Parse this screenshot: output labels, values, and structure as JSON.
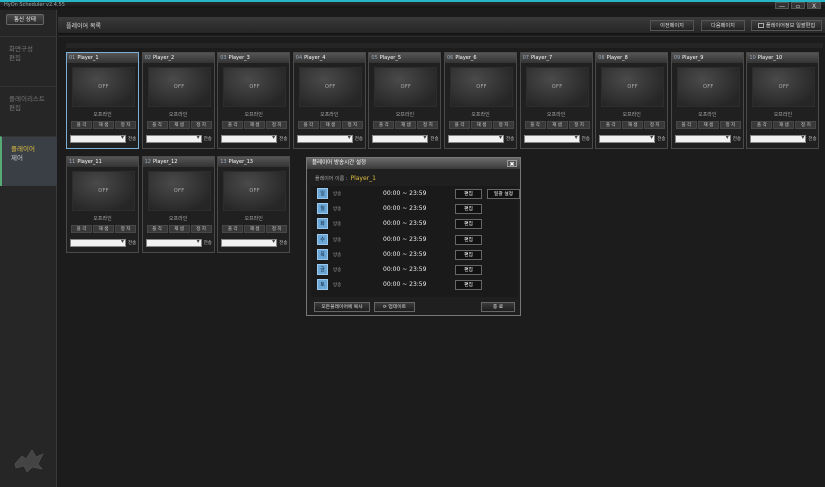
{
  "window": {
    "title": "HyOn Scheduler v2.4.55",
    "min": "—",
    "max": "▫",
    "close": "X"
  },
  "sidebar": {
    "comm_button": "통신 상태",
    "items": [
      {
        "line1": "화면구성",
        "line2": "편집"
      },
      {
        "line1": "플레이리스트",
        "line2": "편집"
      },
      {
        "line1": "플레이어",
        "line2": "제어"
      }
    ]
  },
  "header": {
    "title": "플레이어 목록",
    "prev": "이전페이지",
    "next": "다음페이지",
    "info": "플레이어정보 일괄편집"
  },
  "card_labels": {
    "screen": "OFF",
    "status": "오프라인",
    "play": "플 각",
    "reset": "재 샘",
    "stop": "정 지",
    "send": "전송"
  },
  "players": [
    {
      "num": "01",
      "name": "Player_1"
    },
    {
      "num": "02",
      "name": "Player_2"
    },
    {
      "num": "03",
      "name": "Player_3"
    },
    {
      "num": "04",
      "name": "Player_4"
    },
    {
      "num": "05",
      "name": "Player_5"
    },
    {
      "num": "06",
      "name": "Player_6"
    },
    {
      "num": "07",
      "name": "Player_7"
    },
    {
      "num": "08",
      "name": "Player_8"
    },
    {
      "num": "09",
      "name": "Player_9"
    },
    {
      "num": "10",
      "name": "Player_10"
    },
    {
      "num": "11",
      "name": "Player_11"
    },
    {
      "num": "12",
      "name": "Player_12"
    },
    {
      "num": "13",
      "name": "Player_13"
    }
  ],
  "dialog": {
    "title": "플레이어 방송시간 설정",
    "close": "✖",
    "player_label": "플레이어 이름 :",
    "player_name": "Player_1",
    "edit_label": "편집",
    "batch_label": "일괄 설정",
    "rows": [
      {
        "day": "일",
        "label": "방송",
        "time": "00:00 ~ 23:59"
      },
      {
        "day": "월",
        "label": "방송",
        "time": "00:00 ~ 23:59"
      },
      {
        "day": "화",
        "label": "방송",
        "time": "00:00 ~ 23:59"
      },
      {
        "day": "수",
        "label": "방송",
        "time": "00:00 ~ 23:59"
      },
      {
        "day": "목",
        "label": "방송",
        "time": "00:00 ~ 23:59"
      },
      {
        "day": "금",
        "label": "방송",
        "time": "00:00 ~ 23:59"
      },
      {
        "day": "토",
        "label": "방송",
        "time": "00:00 ~ 23:59"
      }
    ],
    "apply_all": "모든플레이어에 복사",
    "update": "⟳ 업데이트",
    "close_button": "종 료"
  },
  "colors": {
    "accent": "#27b7c9",
    "selected_border": "#7ab0d8",
    "day_badge": "#6aa6d6",
    "highlight_text": "#e0c040"
  }
}
